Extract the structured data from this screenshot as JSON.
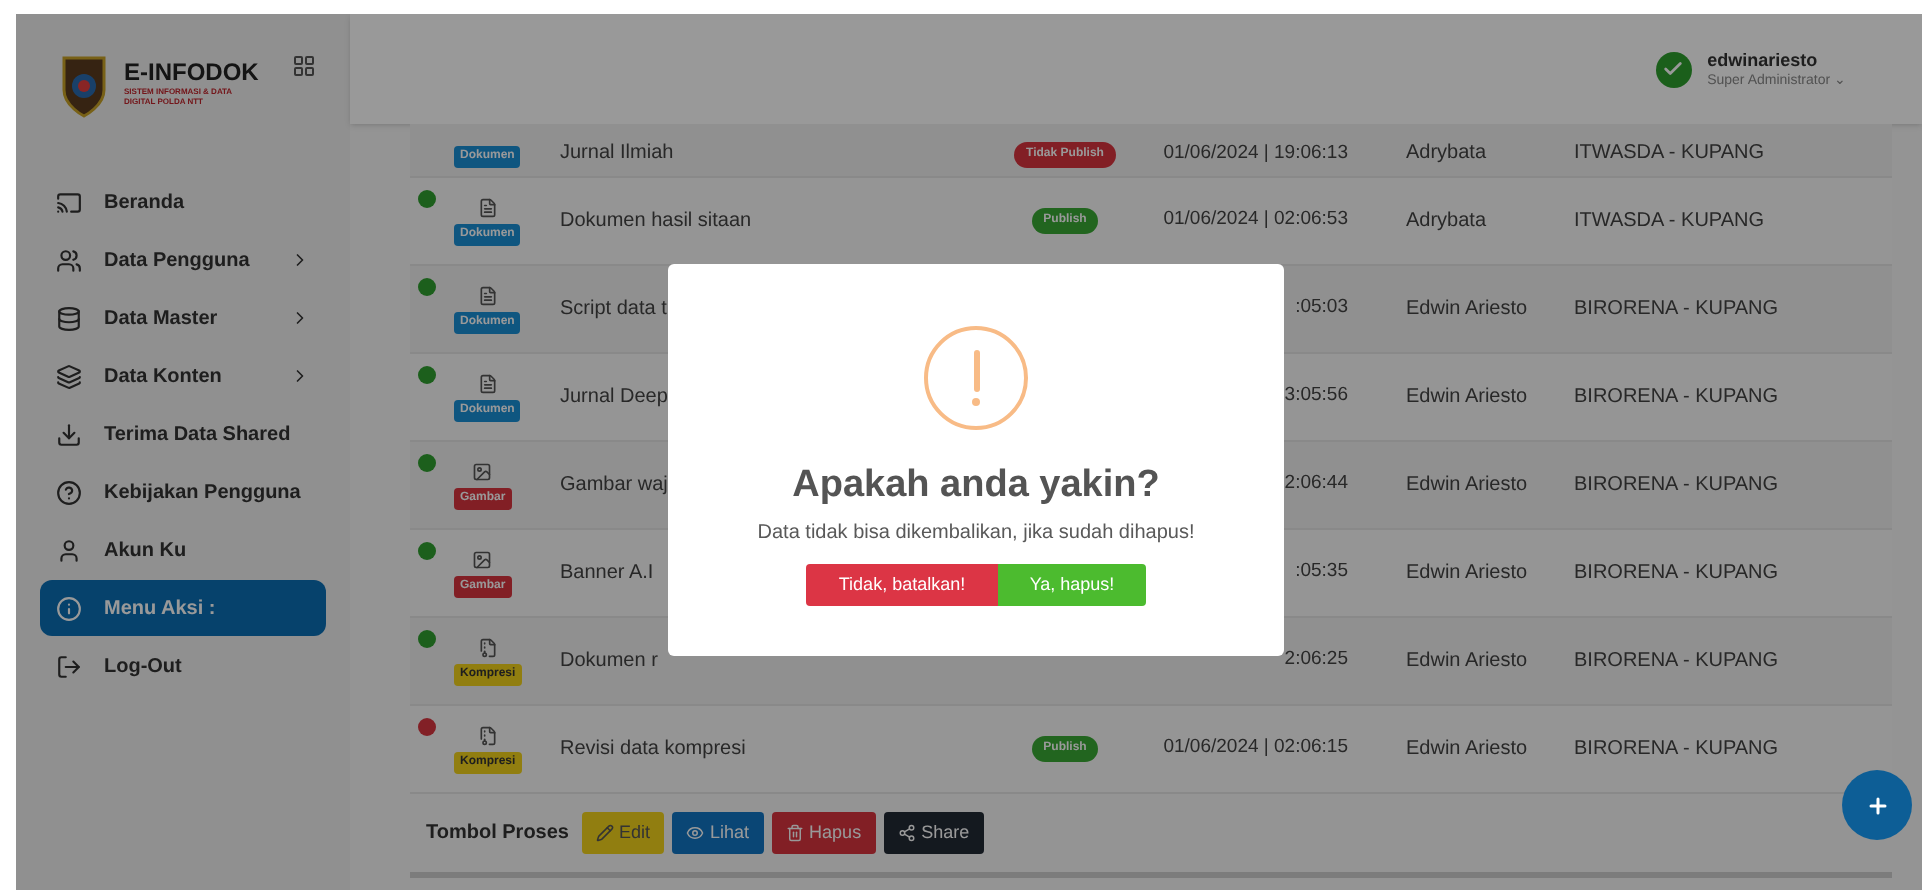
{
  "brand": {
    "title": "E-INFODOK",
    "subtitle": "SISTEM INFORMASI & DATA DIGITAL POLDA NTT"
  },
  "sidebar": {
    "items": [
      {
        "label": "Beranda",
        "has_children": false,
        "selected": false
      },
      {
        "label": "Data Pengguna",
        "has_children": true,
        "selected": false
      },
      {
        "label": "Data Master",
        "has_children": true,
        "selected": false
      },
      {
        "label": "Data Konten",
        "has_children": true,
        "selected": false
      },
      {
        "label": "Terima Data Shared",
        "has_children": false,
        "selected": false
      },
      {
        "label": "Kebijakan Pengguna",
        "has_children": false,
        "selected": false
      },
      {
        "label": "Akun Ku",
        "has_children": false,
        "selected": false
      },
      {
        "label": "Menu Aksi :",
        "has_children": false,
        "selected": true
      },
      {
        "label": "Log-Out",
        "has_children": false,
        "selected": false
      }
    ]
  },
  "user": {
    "name": "edwinariesto",
    "role": "Super Administrator ⌄"
  },
  "table": {
    "rows": [
      {
        "kind": "dokumen",
        "type": "Dokumen",
        "name": "Jurnal Ilmiah",
        "status": "Tidak Publish",
        "published": false,
        "datetime": "01/06/2024 | 19:06:13",
        "user": "Adrybata",
        "unit": "ITWASDA - KUPANG"
      },
      {
        "kind": "dokumen",
        "type": "Dokumen",
        "color": "#1c5f1c",
        "name": "Dokumen hasil sitaan",
        "status": "Publish",
        "published": true,
        "datetime": "01/06/2024 | 02:06:53",
        "user": "Adrybata",
        "unit": "ITWASDA - KUPANG"
      },
      {
        "kind": "dokumen",
        "type": "Dokumen",
        "color": "#1c5f1c",
        "name": "Script data t",
        "datetime": ":05:03",
        "user": "Edwin Ariesto",
        "unit": "BIRORENA - KUPANG"
      },
      {
        "kind": "dokumen",
        "type": "Dokumen",
        "color": "#1c5f1c",
        "name": "Jurnal Deep",
        "datetime": "3:05:56",
        "user": "Edwin Ariesto",
        "unit": "BIRORENA - KUPANG"
      },
      {
        "kind": "gambar",
        "type": "Gambar",
        "color": "#1c5f1c",
        "name": "Gambar waj",
        "datetime": "2:06:44",
        "user": "Edwin Ariesto",
        "unit": "BIRORENA - KUPANG"
      },
      {
        "kind": "gambar",
        "type": "Gambar",
        "color": "#1c5f1c",
        "name": "Banner A.I",
        "datetime": ":05:35",
        "user": "Edwin Ariesto",
        "unit": "BIRORENA - KUPANG"
      },
      {
        "kind": "kompresi",
        "type": "Kompresi",
        "color": "#1c5f1c",
        "name": "Dokumen r",
        "datetime": "2:06:25",
        "user": "Edwin Ariesto",
        "unit": "BIRORENA - KUPANG"
      },
      {
        "kind": "kompresi",
        "type": "Kompresi",
        "color": "#822026",
        "name": "Revisi data kompresi",
        "status": "Publish",
        "published": true,
        "datetime": "01/06/2024 | 02:06:15",
        "user": "Edwin Ariesto",
        "unit": "BIRORENA - KUPANG"
      }
    ]
  },
  "actions": {
    "label": "Tombol Proses",
    "buttons": [
      {
        "kind": "edit",
        "label": "Edit"
      },
      {
        "kind": "view",
        "label": "Lihat"
      },
      {
        "kind": "delete",
        "label": "Hapus"
      },
      {
        "kind": "share",
        "label": "Share"
      }
    ]
  },
  "dialog": {
    "title": "Apakah anda yakin?",
    "message": "Data tidak bisa dikembalikan, jika sudah dihapus!",
    "cancel": "Tidak, batalkan!",
    "confirm": "Ya, hapus!"
  }
}
